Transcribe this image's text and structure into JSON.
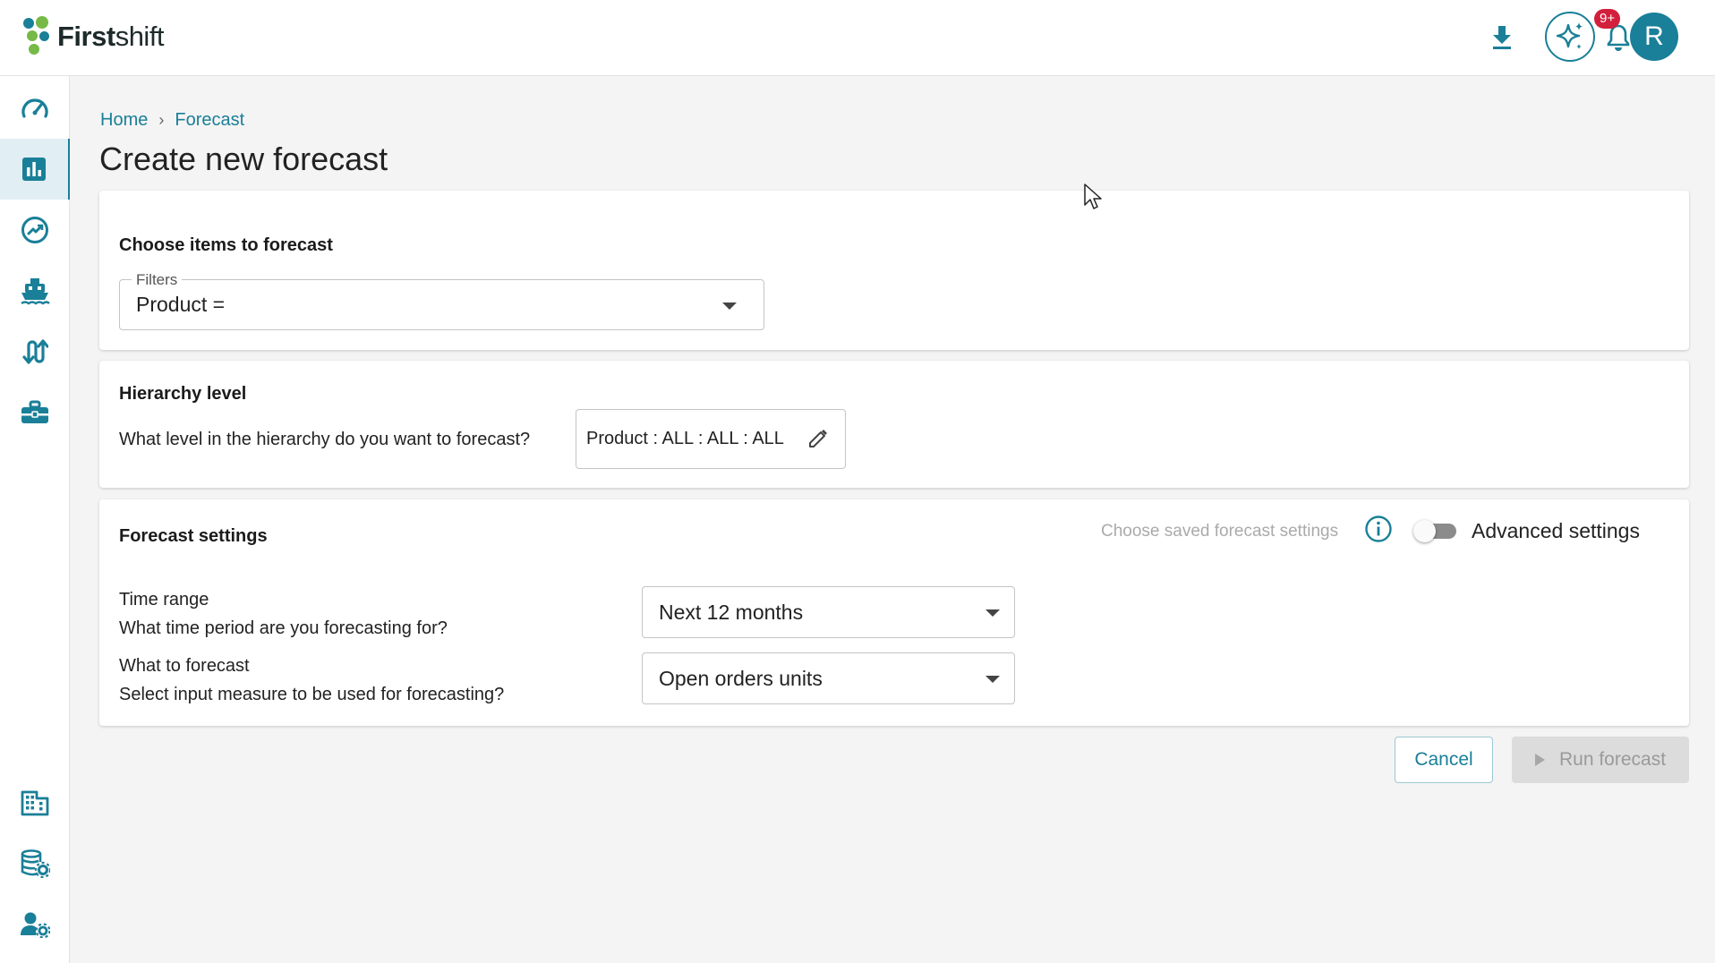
{
  "app": {
    "logo_text_bold": "First",
    "logo_text_light": "shift",
    "notification_badge": "9+",
    "avatar_initial": "R",
    "colors": {
      "accent": "#1a7f98",
      "badge": "#d21f3c",
      "logo_green": "#76b947",
      "logo_teal": "#1a7f98"
    }
  },
  "header": {
    "icons": [
      "download-icon",
      "ai-sparkle-icon",
      "bell-icon"
    ]
  },
  "sidebar": {
    "items": [
      {
        "icon": "dashboard-gauge-icon",
        "active": false
      },
      {
        "icon": "bar-chart-icon",
        "active": true
      },
      {
        "icon": "trending-icon",
        "active": false
      },
      {
        "icon": "ship-icon",
        "active": false
      },
      {
        "icon": "swap-arrows-icon",
        "active": false
      },
      {
        "icon": "briefcase-icon",
        "active": false
      }
    ],
    "bottom_items": [
      {
        "icon": "building-icon"
      },
      {
        "icon": "database-settings-icon"
      },
      {
        "icon": "user-settings-icon"
      }
    ]
  },
  "breadcrumb": {
    "home": "Home",
    "current": "Forecast",
    "separator": "›"
  },
  "page_title": "Create new forecast",
  "items_section": {
    "title": "Choose items to forecast",
    "filter_label": "Filters",
    "filter_value": "Product ="
  },
  "hierarchy_section": {
    "title": "Hierarchy level",
    "question": "What level in the hierarchy do you want to forecast?",
    "value": "Product : ALL : ALL : ALL"
  },
  "settings_section": {
    "title": "Forecast settings",
    "saved_settings_link": "Choose saved forecast settings",
    "advanced_label": "Advanced settings",
    "advanced_enabled": false,
    "time_range_label": "Time range",
    "time_range_question": "What time period are you forecasting for?",
    "time_range_value": "Next 12 months",
    "measure_label": "What to forecast",
    "measure_question": "Select input measure to be used for forecasting?",
    "measure_value": "Open orders units"
  },
  "actions": {
    "cancel": "Cancel",
    "run": "Run forecast"
  }
}
